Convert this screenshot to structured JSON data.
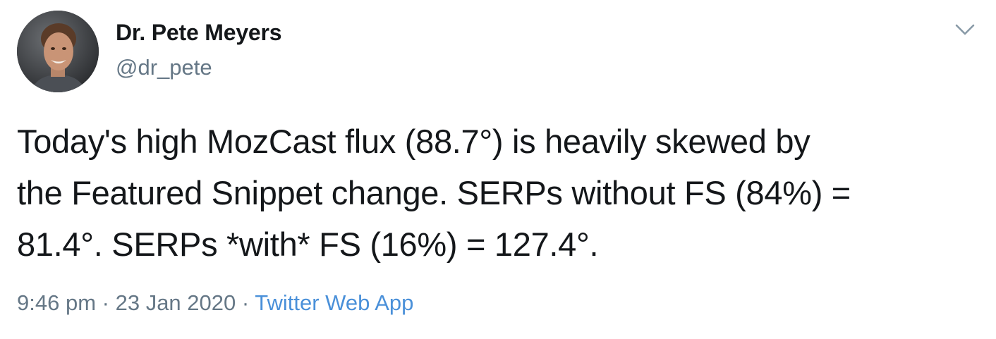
{
  "tweet": {
    "author_name": "Dr. Pete Meyers",
    "author_handle": "@dr_pete",
    "text_lines": [
      "Today's high MozCast flux (88.7°) is heavily skewed by",
      "the Featured Snippet change. SERPs without FS (84%) =",
      "81.4°. SERPs *with* FS (16%) = 127.4°."
    ],
    "time": "9:46 pm",
    "separator": "·",
    "date": "23 Jan 2020",
    "source": "Twitter Web App",
    "menu_icon": "chevron-down-icon"
  },
  "colors": {
    "text": "#14171a",
    "secondary": "#657786",
    "link": "#4a90d9"
  }
}
